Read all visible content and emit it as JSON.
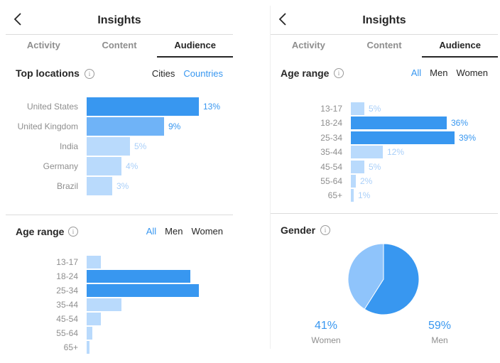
{
  "colors": {
    "bar_dark": "#3897f0",
    "bar_mid": "#6fb3f7",
    "bar_light": "#b9dafc",
    "accent": "#3897f0",
    "pie_men": "#3897f0",
    "pie_women": "#8fc4fb"
  },
  "left": {
    "title": "Insights",
    "tabs": [
      "Activity",
      "Content",
      "Audience"
    ],
    "top_locations": {
      "title": "Top locations",
      "filters": [
        "Cities",
        "Countries"
      ],
      "active_filter": "Countries",
      "rows": [
        {
          "label": "United States",
          "value": 13,
          "text": "13%"
        },
        {
          "label": "United Kingdom",
          "value": 9,
          "text": "9%"
        },
        {
          "label": "India",
          "value": 5,
          "text": "5%"
        },
        {
          "label": "Germany",
          "value": 4,
          "text": "4%"
        },
        {
          "label": "Brazil",
          "value": 3,
          "text": "3%"
        }
      ]
    },
    "age_range": {
      "title": "Age range",
      "filters": [
        "All",
        "Men",
        "Women"
      ],
      "active_filter": "All",
      "rows": [
        {
          "label": "13-17",
          "value": 5
        },
        {
          "label": "18-24",
          "value": 36
        },
        {
          "label": "25-34",
          "value": 39
        },
        {
          "label": "35-44",
          "value": 12
        },
        {
          "label": "45-54",
          "value": 5
        },
        {
          "label": "55-64",
          "value": 2
        },
        {
          "label": "65+",
          "value": 1
        }
      ]
    }
  },
  "right": {
    "title": "Insights",
    "tabs": [
      "Activity",
      "Content",
      "Audience"
    ],
    "age_range": {
      "title": "Age range",
      "filters": [
        "All",
        "Men",
        "Women"
      ],
      "active_filter": "All",
      "rows": [
        {
          "label": "13-17",
          "value": 5,
          "text": "5%"
        },
        {
          "label": "18-24",
          "value": 36,
          "text": "36%"
        },
        {
          "label": "25-34",
          "value": 39,
          "text": "39%"
        },
        {
          "label": "35-44",
          "value": 12,
          "text": "12%"
        },
        {
          "label": "45-54",
          "value": 5,
          "text": "5%"
        },
        {
          "label": "55-64",
          "value": 2,
          "text": "2%"
        },
        {
          "label": "65+",
          "value": 1,
          "text": "1%"
        }
      ]
    },
    "gender": {
      "title": "Gender",
      "women": {
        "value": 41,
        "text": "41%",
        "label": "Women"
      },
      "men": {
        "value": 59,
        "text": "59%",
        "label": "Men"
      }
    }
  }
}
